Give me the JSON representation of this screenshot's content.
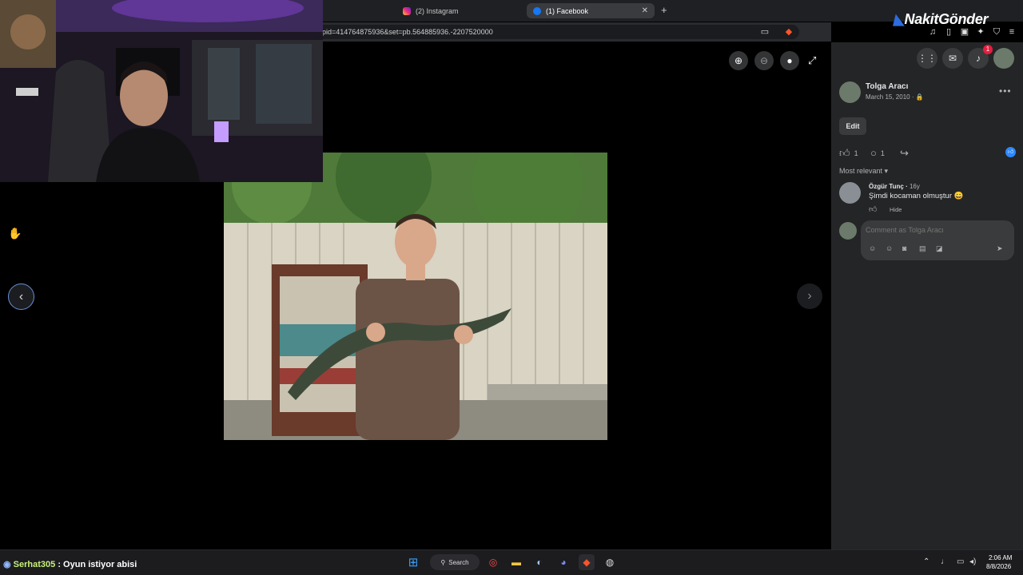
{
  "browser": {
    "tabs": [
      {
        "label": "(2) Instagram",
        "active": false
      },
      {
        "label": "(1) Facebook",
        "active": true
      }
    ],
    "url": "pid=414764875936&set=pb.564885936.-2207520000",
    "brand_overlay": "NakitGönder"
  },
  "viewer": {
    "zoom_in_icon": "zoom-in-icon",
    "zoom_out_icon": "zoom-out-icon",
    "tag_icon": "tag-icon",
    "fullscreen_icon": "fullscreen-icon"
  },
  "post": {
    "author": "Tolga Aracı",
    "date": "March 15, 2010 · ",
    "edit_label": "Edit",
    "like_count": "1",
    "comment_count": "1",
    "sort_label": "Most relevant",
    "comment": {
      "author": "Özgür Tunç",
      "age": "16y",
      "text": "Şimdi kocaman olmuştur 😀",
      "hide_label": "Hide"
    },
    "composer_placeholder": "Comment as Tolga Aracı"
  },
  "header": {
    "notification_count": "1"
  },
  "stream_chat": {
    "user": "Serhat305",
    "message": "Oyun istiyor abisi"
  },
  "taskbar": {
    "search_label": "Search",
    "time": "2:06 AM",
    "date": "8/8/2026"
  }
}
